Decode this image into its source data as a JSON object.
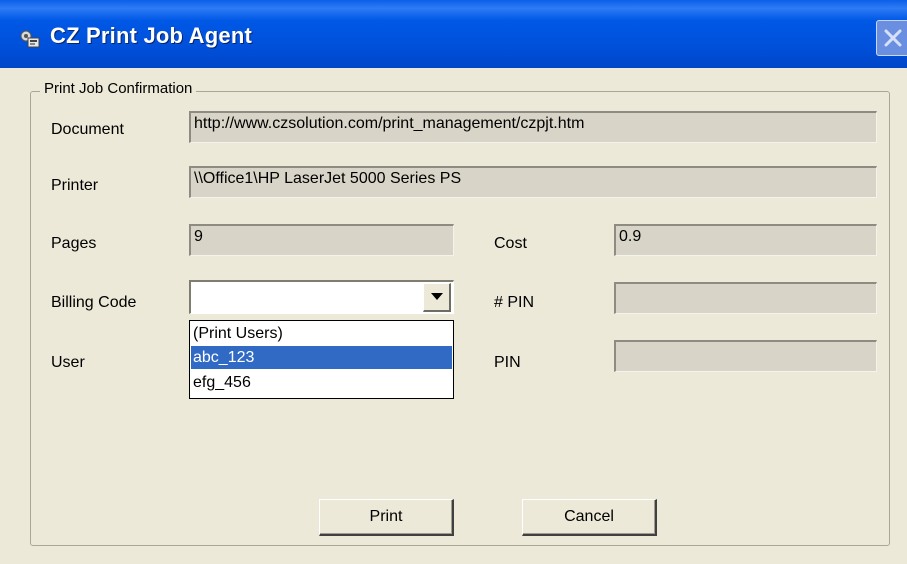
{
  "window": {
    "title": "CZ Print Job Agent"
  },
  "group": {
    "title": "Print Job Confirmation"
  },
  "fields": {
    "document": {
      "label": "Document",
      "value": "http://www.czsolution.com/print_management/czpjt.htm"
    },
    "printer": {
      "label": "Printer",
      "value": "\\\\Office1\\HP LaserJet 5000 Series PS"
    },
    "pages": {
      "label": "Pages",
      "value": "9"
    },
    "cost": {
      "label": "Cost",
      "value": "0.9"
    },
    "billing_code": {
      "label": "Billing Code",
      "value": ""
    },
    "pin_count": {
      "label": "# PIN",
      "value": ""
    },
    "user": {
      "label": "User"
    },
    "pin": {
      "label": "PIN",
      "value": ""
    }
  },
  "dropdown": {
    "options": [
      "(Print Users)",
      "abc_123",
      "efg_456"
    ],
    "selected": "abc_123"
  },
  "buttons": {
    "print": "Print",
    "cancel": "Cancel"
  },
  "icons": {
    "title": "printer-agent-icon",
    "close": "close-icon",
    "dropdown": "chevron-down-icon"
  },
  "colors": {
    "titlebar": "#0054E3",
    "selection": "#316AC5",
    "dialog_bg": "#ECE9D8",
    "readonly_field": "#D8D4C8"
  }
}
